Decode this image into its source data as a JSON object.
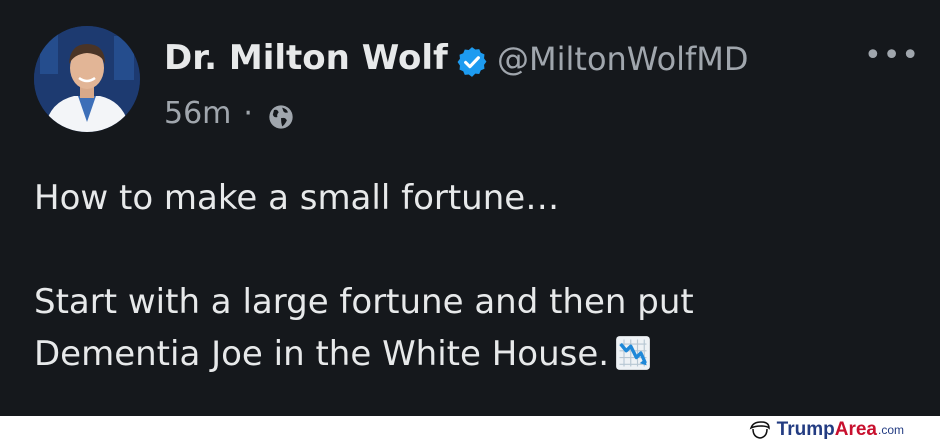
{
  "tweet": {
    "author": {
      "name": "Dr. Milton Wolf",
      "handle": "@MiltonWolfMD",
      "verified": true,
      "avatar": "profile-photo"
    },
    "time": "56m",
    "separator": "·",
    "visibility_icon": "globe-icon",
    "more_icon": "•••",
    "lines": [
      "How to make a small fortune…",
      "Start with a large fortune and then put",
      "Dementia Joe in the White House."
    ],
    "emoji": "chart-decreasing-icon"
  },
  "watermark": {
    "brand_part1": "Trump",
    "brand_part2": "Area",
    "brand_suffix": ".com"
  },
  "colors": {
    "background": "#15181c",
    "text": "#e7e9ea",
    "secondary": "#a0a6ad",
    "verified": "#1d9bf0"
  }
}
